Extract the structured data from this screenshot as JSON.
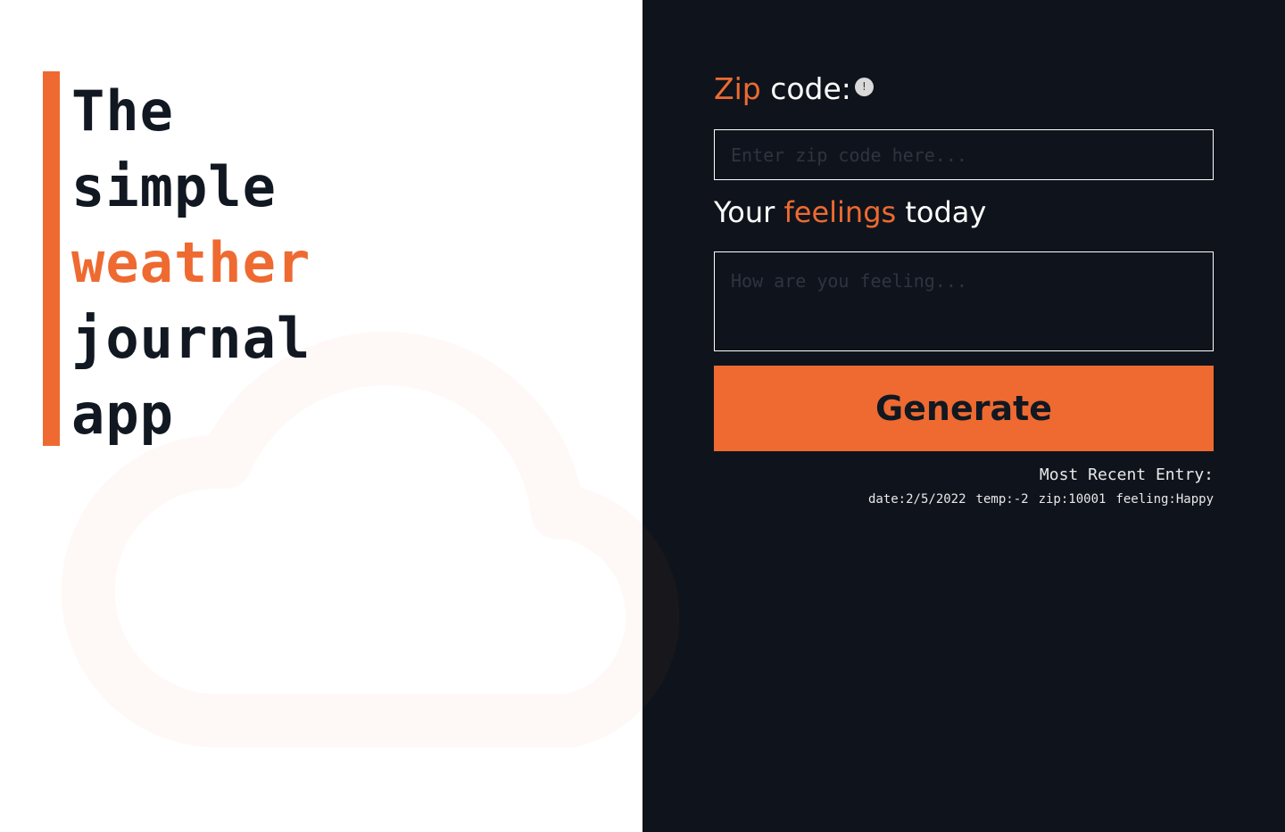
{
  "hero": {
    "line1": "The",
    "line2": "simple",
    "line3": "weather",
    "line4": "journal",
    "line5": "app"
  },
  "zip": {
    "label_accent": "Zip",
    "label_rest": " code:",
    "info_icon": "!",
    "placeholder": "Enter zip code here..."
  },
  "feelings": {
    "label_prefix": "Your ",
    "label_accent": "feelings",
    "label_suffix": " today",
    "placeholder": "How are you feeling..."
  },
  "generate_button": {
    "label": "Generate"
  },
  "recent": {
    "heading": "Most Recent Entry:",
    "date": "date:2/5/2022",
    "temp": "temp:-2",
    "zip": "zip:10001",
    "feeling": "feeling:Happy"
  },
  "colors": {
    "accent": "#ee6a31",
    "dark": "#0f141c",
    "light": "#ffffff"
  },
  "icons": {
    "info": "info-icon",
    "background": "cloud-icon"
  }
}
